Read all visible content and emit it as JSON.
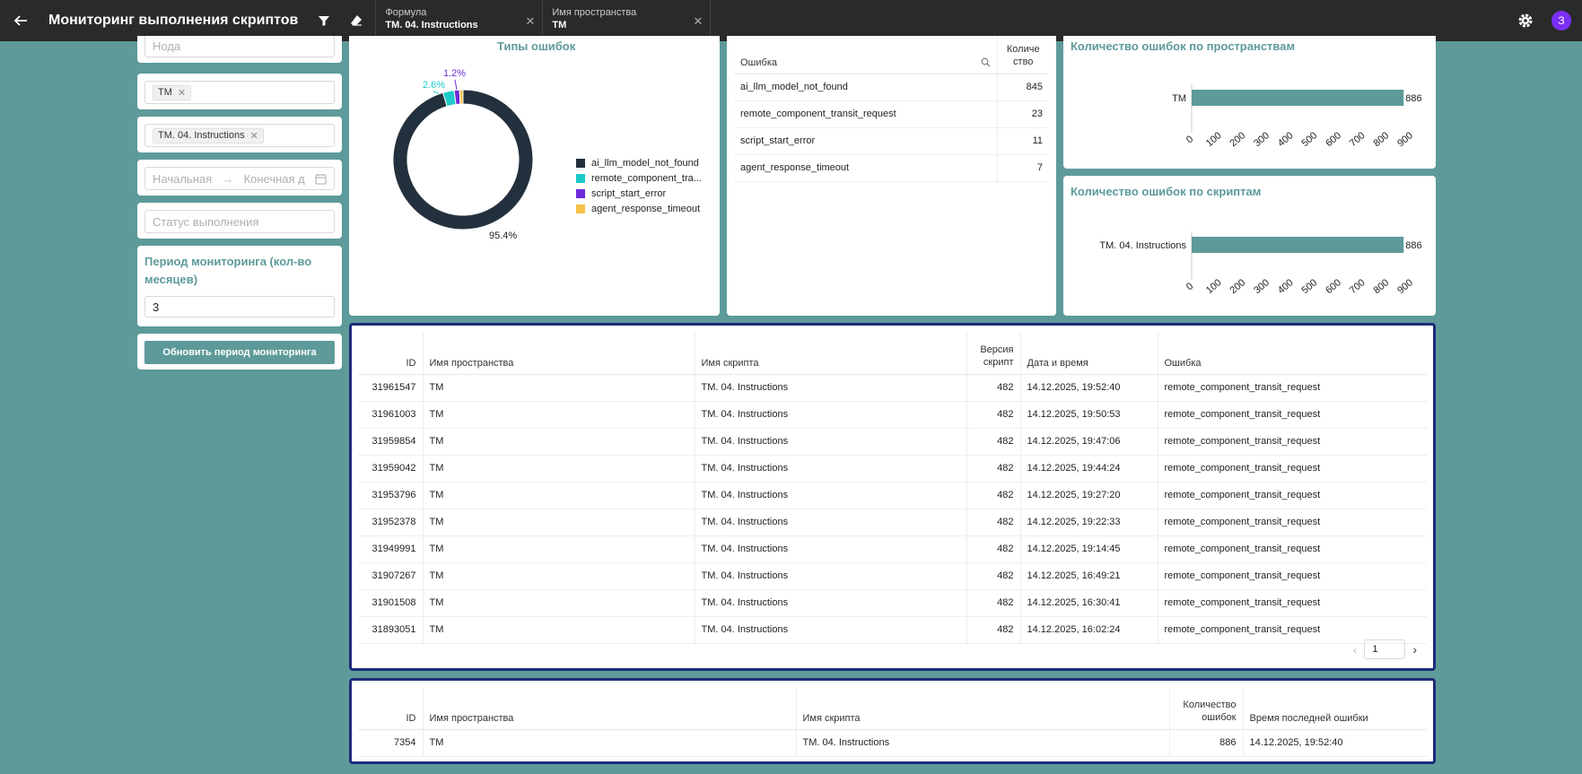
{
  "header": {
    "title": "Мониторинг выполнения скриптов",
    "chips": [
      {
        "label": "Формула",
        "value": "TM. 04. Instructions"
      },
      {
        "label": "Имя пространства",
        "value": "TM"
      }
    ],
    "avatar_letter": "З"
  },
  "filters": {
    "node_placeholder": "Нода",
    "space_tag": "TM",
    "script_tag": "TM. 04. Instructions",
    "date_start_placeholder": "Начальная",
    "date_end_placeholder": "Конечная д",
    "status_placeholder": "Статус выполнения",
    "period_title": "Период мониторинга (кол-во месяцев)",
    "period_value": "3",
    "update_button": "Обновить период мониторинга"
  },
  "chart_types": {
    "title": "Типы ошибок",
    "chart_data": {
      "type": "pie",
      "title": "Типы ошибок",
      "labels": [
        "ai_llm_model_not_found",
        "remote_component_transit_request",
        "script_start_error",
        "agent_response_timeout"
      ],
      "legend_labels": [
        "ai_llm_model_not_found",
        "remote_component_tra...",
        "script_start_error",
        "agent_response_timeout"
      ],
      "values": [
        845,
        23,
        11,
        7
      ],
      "percent_labels": [
        "95.4%",
        "2.6%",
        "1.2%",
        ""
      ],
      "colors": [
        "#23303d",
        "#1ecac9",
        "#6e2bd9",
        "#f5c34a"
      ],
      "donut": true,
      "legend": "right"
    }
  },
  "error_table": {
    "col_error": "Ошибка",
    "col_count": "Количе ство",
    "rows": [
      {
        "error": "ai_llm_model_not_found",
        "count": "845"
      },
      {
        "error": "remote_component_transit_request",
        "count": "23"
      },
      {
        "error": "script_start_error",
        "count": "11"
      },
      {
        "error": "agent_response_timeout",
        "count": "7"
      }
    ]
  },
  "chart_spaces": {
    "title": "Количество ошибок по пространствам",
    "chart_data": {
      "type": "bar",
      "orientation": "horizontal",
      "title": "Количество ошибок по пространствам",
      "categories": [
        "TM"
      ],
      "values": [
        886
      ],
      "value_labels": [
        "886"
      ],
      "xlim": [
        0,
        900
      ],
      "ticks": [
        "0",
        "100",
        "200",
        "300",
        "400",
        "500",
        "600",
        "700",
        "800",
        "900"
      ],
      "color": "#5e9a9a"
    }
  },
  "chart_scripts": {
    "title": "Количество ошибок по скриптам",
    "chart_data": {
      "type": "bar",
      "orientation": "horizontal",
      "title": "Количество ошибок по скриптам",
      "categories": [
        "TM. 04. Instructions"
      ],
      "values": [
        886
      ],
      "value_labels": [
        "886"
      ],
      "xlim": [
        0,
        900
      ],
      "ticks": [
        "0",
        "100",
        "200",
        "300",
        "400",
        "500",
        "600",
        "700",
        "800",
        "900"
      ],
      "color": "#5e9a9a"
    }
  },
  "log_table": {
    "columns": {
      "id": "ID",
      "space": "Имя пространства",
      "script": "Имя скрипта",
      "version": "Версия скрипт",
      "datetime": "Дата и время",
      "error": "Ошибка"
    },
    "rows": [
      {
        "id": "31961547",
        "space": "TM",
        "script": "TM. 04. Instructions",
        "version": "482",
        "datetime": "14.12.2025, 19:52:40",
        "error": "remote_component_transit_request"
      },
      {
        "id": "31961003",
        "space": "TM",
        "script": "TM. 04. Instructions",
        "version": "482",
        "datetime": "14.12.2025, 19:50:53",
        "error": "remote_component_transit_request"
      },
      {
        "id": "31959854",
        "space": "TM",
        "script": "TM. 04. Instructions",
        "version": "482",
        "datetime": "14.12.2025, 19:47:06",
        "error": "remote_component_transit_request"
      },
      {
        "id": "31959042",
        "space": "TM",
        "script": "TM. 04. Instructions",
        "version": "482",
        "datetime": "14.12.2025, 19:44:24",
        "error": "remote_component_transit_request"
      },
      {
        "id": "31953796",
        "space": "TM",
        "script": "TM. 04. Instructions",
        "version": "482",
        "datetime": "14.12.2025, 19:27:20",
        "error": "remote_component_transit_request"
      },
      {
        "id": "31952378",
        "space": "TM",
        "script": "TM. 04. Instructions",
        "version": "482",
        "datetime": "14.12.2025, 19:22:33",
        "error": "remote_component_transit_request"
      },
      {
        "id": "31949991",
        "space": "TM",
        "script": "TM. 04. Instructions",
        "version": "482",
        "datetime": "14.12.2025, 19:14:45",
        "error": "remote_component_transit_request"
      },
      {
        "id": "31907267",
        "space": "TM",
        "script": "TM. 04. Instructions",
        "version": "482",
        "datetime": "14.12.2025, 16:49:21",
        "error": "remote_component_transit_request"
      },
      {
        "id": "31901508",
        "space": "TM",
        "script": "TM. 04. Instructions",
        "version": "482",
        "datetime": "14.12.2025, 16:30:41",
        "error": "remote_component_transit_request"
      },
      {
        "id": "31893051",
        "space": "TM",
        "script": "TM. 04. Instructions",
        "version": "482",
        "datetime": "14.12.2025, 16:02:24",
        "error": "remote_component_transit_request"
      }
    ],
    "page": "1"
  },
  "summary_table": {
    "columns": {
      "id": "ID",
      "space": "Имя пространства",
      "script": "Имя скрипта",
      "count": "Количество ошибок",
      "last": "Время последней ошибки"
    },
    "rows": [
      {
        "id": "7354",
        "space": "TM",
        "script": "TM. 04. Instructions",
        "count": "886",
        "last": "14.12.2025, 19:52:40"
      }
    ]
  }
}
